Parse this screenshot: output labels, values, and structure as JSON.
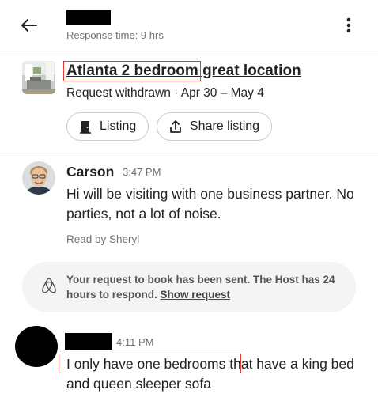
{
  "header": {
    "response_time": "Response time: 9 hrs"
  },
  "listing": {
    "title": "Atlanta 2 bedroom great location",
    "status": "Request withdrawn · Apr 30 – May 4",
    "listing_button": "Listing",
    "share_button": "Share listing"
  },
  "messages": [
    {
      "sender": "Carson",
      "time": "3:47 PM",
      "text": "Hi will be visiting with one business partner. No parties, not a lot of noise.",
      "read_by": "Read by Sheryl"
    },
    {
      "time": "4:11 PM",
      "text": "I only have one bedrooms that have a king bed and queen sleeper sofa"
    }
  ],
  "system_message": {
    "text": "Your request to book has been sent. The Host has 24 hours to respond.",
    "link": "Show request"
  },
  "colors": {
    "accent_red": "#e53935",
    "text_primary": "#222222",
    "text_secondary": "#717171",
    "card_bg": "#f4f4f4"
  }
}
